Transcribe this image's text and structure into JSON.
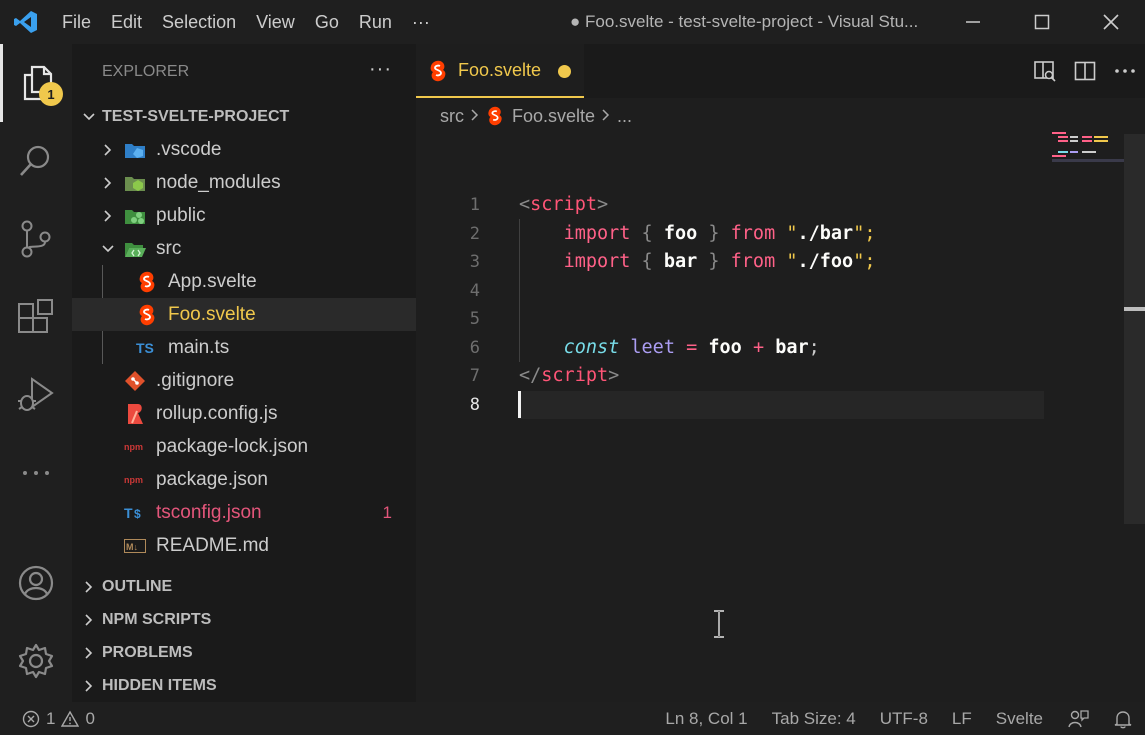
{
  "menu": [
    "File",
    "Edit",
    "Selection",
    "View",
    "Go",
    "Run",
    "···"
  ],
  "window_title": "● Foo.svelte - test-svelte-project - Visual Stu...",
  "activity": {
    "explorer_badge": "1"
  },
  "sidebar": {
    "title": "EXPLORER",
    "more": "···",
    "project": "TEST-SVELTE-PROJECT",
    "tree": [
      {
        "name": ".vscode",
        "kind": "folder"
      },
      {
        "name": "node_modules",
        "kind": "folder"
      },
      {
        "name": "public",
        "kind": "folder"
      },
      {
        "name": "src",
        "kind": "folder-open"
      },
      {
        "name": "App.svelte",
        "kind": "svelte"
      },
      {
        "name": "Foo.svelte",
        "kind": "svelte"
      },
      {
        "name": "main.ts",
        "kind": "ts"
      },
      {
        "name": ".gitignore",
        "kind": "git"
      },
      {
        "name": "rollup.config.js",
        "kind": "rollup"
      },
      {
        "name": "package-lock.json",
        "kind": "npm"
      },
      {
        "name": "package.json",
        "kind": "npm"
      },
      {
        "name": "tsconfig.json",
        "kind": "tsconfig",
        "problems": "1"
      },
      {
        "name": "README.md",
        "kind": "markdown"
      }
    ],
    "sections": [
      "OUTLINE",
      "NPM SCRIPTS",
      "PROBLEMS",
      "HIDDEN ITEMS"
    ]
  },
  "editor": {
    "tab_label": "Foo.svelte",
    "breadcrumb": [
      "src",
      "Foo.svelte",
      "..."
    ],
    "line_numbers": [
      "1",
      "2",
      "3",
      "4",
      "5",
      "6",
      "7",
      "8"
    ],
    "code": {
      "l1_open": "<",
      "l1_tag": "script",
      "l1_close": ">",
      "l2_import": "import",
      "l2_lb": " { ",
      "l2_name": "foo",
      "l2_rb": " } ",
      "l2_from": "from",
      "l2_q1": " \"",
      "l2_path": "./bar",
      "l2_q2": "\";",
      "l3_import": "import",
      "l3_lb": " { ",
      "l3_name": "bar",
      "l3_rb": " } ",
      "l3_from": "from",
      "l3_q1": " \"",
      "l3_path": "./foo",
      "l3_q2": "\";",
      "l6_const": "const",
      "l6_var": "leet",
      "l6_eq": " = ",
      "l6_a": "foo",
      "l6_plus": " + ",
      "l6_b": "bar",
      "l6_semi": ";",
      "l7_open": "</",
      "l7_tag": "script",
      "l7_close": ">"
    }
  },
  "status": {
    "errors": "1",
    "warnings": "0",
    "position": "Ln 8, Col 1",
    "tab_size": "Tab Size: 4",
    "encoding": "UTF-8",
    "eol": "LF",
    "language": "Svelte"
  },
  "colors": {
    "accent": "#f0c84c",
    "svelte": "#ff3e00",
    "error": "#e4567b"
  }
}
